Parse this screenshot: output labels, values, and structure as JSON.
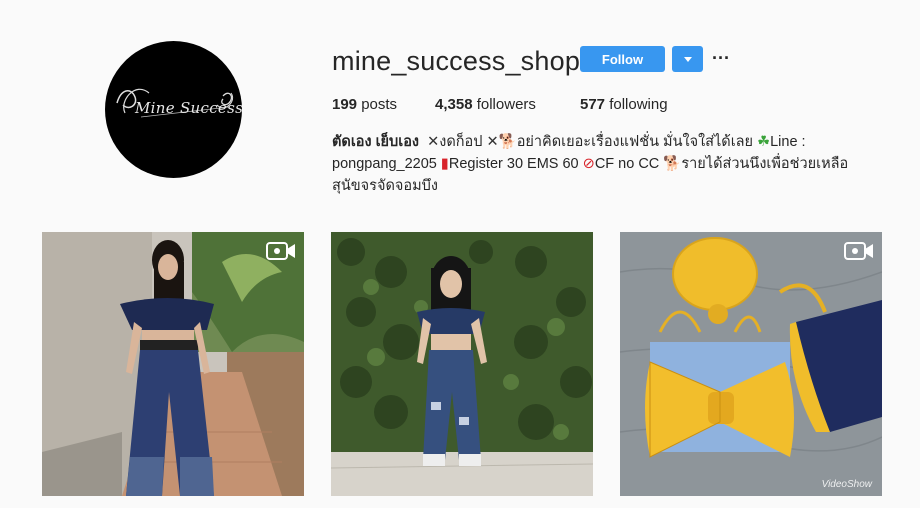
{
  "profile": {
    "avatar_logo_text": "Mine Success",
    "username": "mine_success_shop",
    "follow_label": "Follow",
    "more_label": "···"
  },
  "stats": {
    "posts_count": "199",
    "posts_label": "posts",
    "followers_count": "4,358",
    "followers_label": "followers",
    "following_count": "577",
    "following_label": "following"
  },
  "bio": {
    "name": "ตัดเอง เย็บเอง",
    "line1_a": "งดก็อป",
    "line1_b": "อย่าคิดเยอะเรื่องแฟชั่น มั่นใจใส่ได้เลย",
    "line1_c": "Line :",
    "line2_a": "pongpang_2205",
    "line2_b": "Register 30 EMS 60",
    "line2_c": "CF no CC",
    "line2_d": "รายได้ส่วนนึงเพื่อช่วยเหลือ",
    "line3": "สุนัขจรจัดจอมบึง"
  },
  "posts": [
    {
      "type": "video",
      "icon": "video-icon"
    },
    {
      "type": "image"
    },
    {
      "type": "video",
      "icon": "video-icon",
      "watermark": "VideoShow"
    }
  ],
  "colors": {
    "accent": "#3897f0",
    "background": "#fafafa",
    "text": "#262626"
  }
}
